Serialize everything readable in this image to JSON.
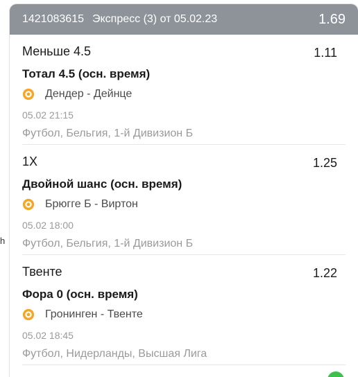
{
  "ticket": {
    "id": "1421083615",
    "type": "Экспресс (3) от 05.02.23",
    "odds": "1.69"
  },
  "bets": [
    {
      "pick": "Меньше 4.5",
      "odds": "1.11",
      "market": "Тотал 4.5 (осн. время)",
      "event": "Дендер - Дейнце",
      "time": "05.02 21:15",
      "league": "Футбол, Бельгия, 1-й Дивизион Б",
      "icon": "soccer-ball-icon"
    },
    {
      "pick": "1X",
      "odds": "1.25",
      "market": "Двойной шанс (осн. время)",
      "event": "Брюгге Б - Виртон",
      "time": "05.02 18:00",
      "league": "Футбол, Бельгия, 1-й Дивизион Б",
      "icon": "soccer-ball-icon"
    },
    {
      "pick": "Твенте",
      "odds": "1.22",
      "market": "Фора 0 (осн. время)",
      "event": "Гронинген - Твенте",
      "time": "05.02 18:45",
      "league": "Футбол, Нидерланды, Высшая Лига",
      "icon": "soccer-ball-icon"
    }
  ],
  "colors": {
    "header_bg": "#8e939a",
    "ball": "#f5a623",
    "status_green": "#3fbf4b"
  }
}
